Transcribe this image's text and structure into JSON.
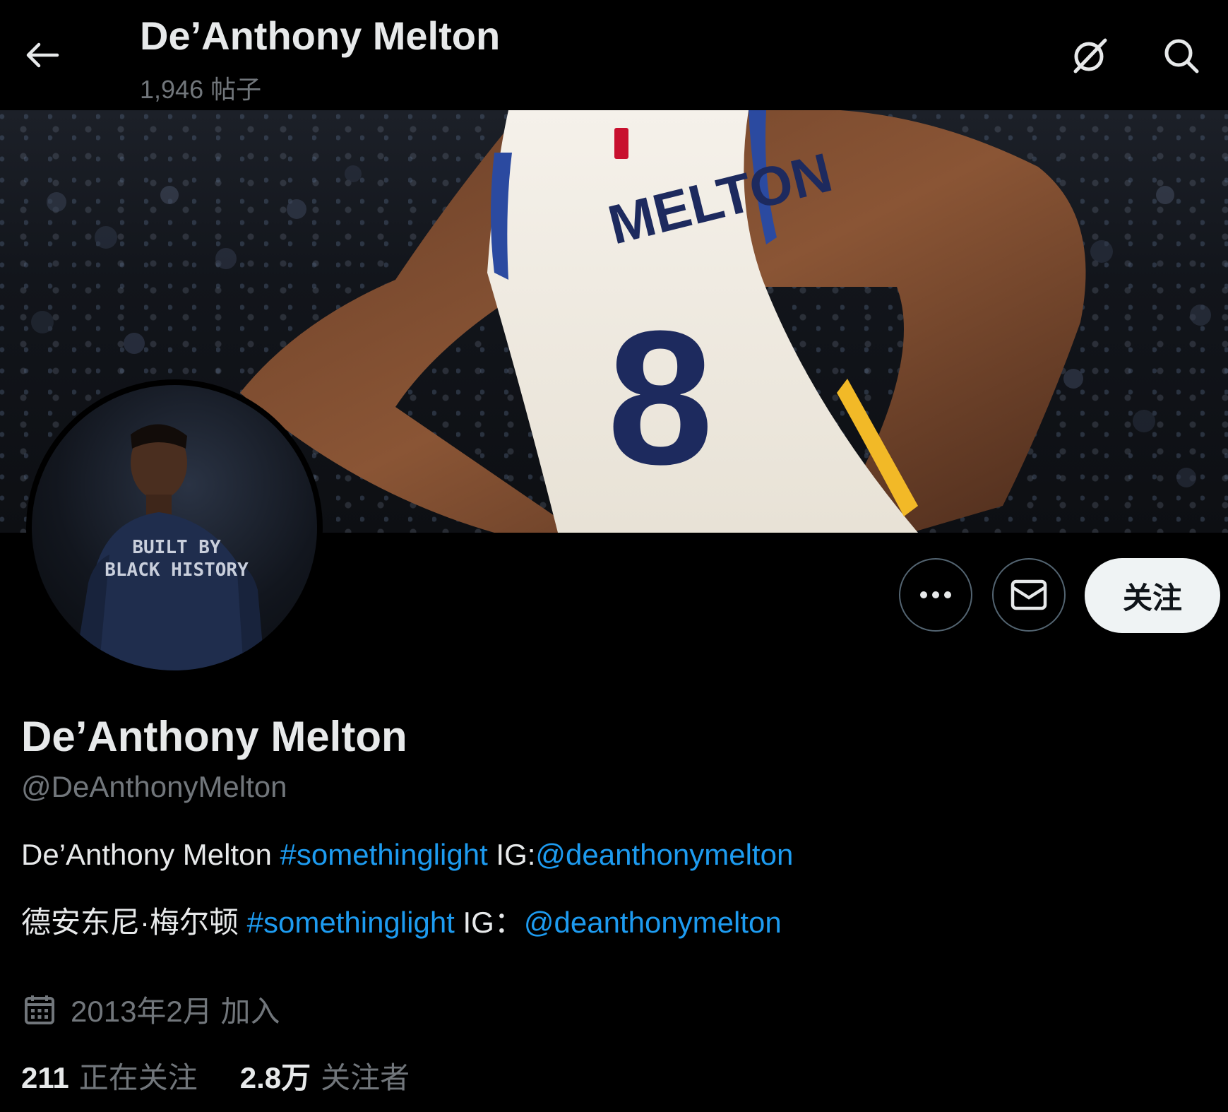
{
  "header": {
    "title": "De’Anthony Melton",
    "post_count": "1,946 帖子",
    "back_icon": "arrow-left-icon",
    "grok_icon": "grok-icon",
    "search_icon": "search-icon"
  },
  "banner": {
    "jersey_name": "MELTON",
    "jersey_number": "8"
  },
  "avatar": {
    "shirt_line1": "BUILT BY",
    "shirt_line2": "BLACK HISTORY"
  },
  "actions": {
    "more_icon": "more-icon",
    "message_icon": "envelope-icon",
    "follow_label": "关注"
  },
  "profile": {
    "display_name": "De’Anthony Melton",
    "handle": "@DeAnthonyMelton",
    "bio_line1": {
      "text1": "De’Anthony Melton ",
      "hashtag": "#somethinglight",
      "text2": " IG:",
      "mention": "@deanthonymelton"
    },
    "bio_line2": {
      "text1": "德安东尼·梅尔顿 ",
      "hashtag": "#somethinglight",
      "text2": " IG：",
      "mention": "@deanthonymelton"
    },
    "joined": "2013年2月 加入"
  },
  "stats": {
    "following_count": "211",
    "following_label": "正在关注",
    "followers_count": "2.8万",
    "followers_label": "关注者"
  },
  "colors": {
    "background": "#000000",
    "text": "#e7e9ea",
    "secondary": "#71767b",
    "link": "#1d9bf0",
    "follow_bg": "#eff3f4"
  }
}
